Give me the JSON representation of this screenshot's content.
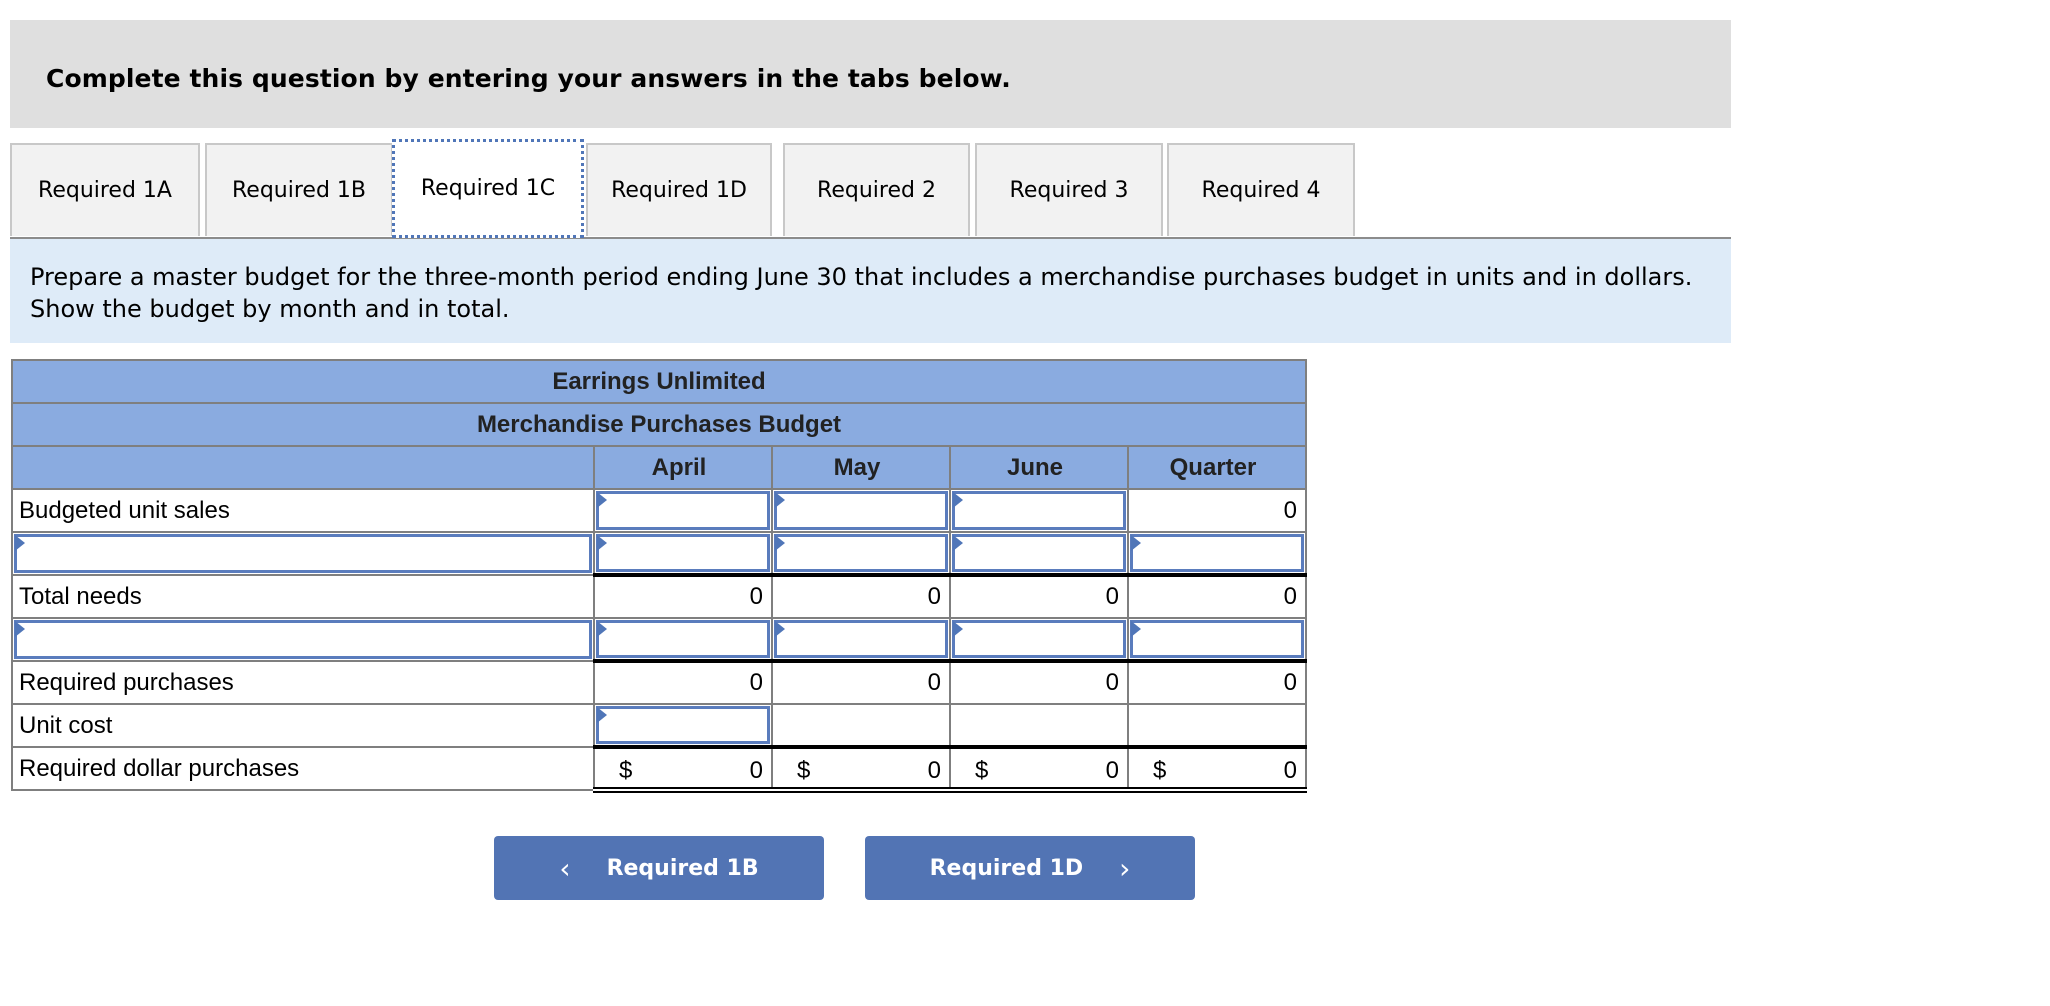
{
  "instruction": "Complete this question by entering your answers in the tabs below.",
  "tabs": [
    {
      "label": "Required 1A",
      "active": false
    },
    {
      "label": "Required 1B",
      "active": false
    },
    {
      "label": "Required 1C",
      "active": true
    },
    {
      "label": "Required 1D",
      "active": false
    },
    {
      "label": "Required 2",
      "active": false
    },
    {
      "label": "Required 3",
      "active": false
    },
    {
      "label": "Required 4",
      "active": false
    }
  ],
  "description": "Prepare a master budget for the three-month period ending June 30 that includes a merchandise purchases budget in units and in dollars. Show the budget by month and in total.",
  "table": {
    "company": "Earrings Unlimited",
    "title": "Merchandise Purchases Budget",
    "columns": [
      "April",
      "May",
      "June",
      "Quarter"
    ],
    "rows": [
      {
        "label": "Budgeted unit sales",
        "label_input": false,
        "cells": [
          "",
          "",
          "",
          "0"
        ],
        "inputs": [
          true,
          true,
          true,
          false
        ]
      },
      {
        "label": "",
        "label_input": true,
        "cells": [
          "",
          "",
          "",
          ""
        ],
        "inputs": [
          true,
          true,
          true,
          true
        ]
      },
      {
        "label": "Total needs",
        "label_input": false,
        "cells": [
          "0",
          "0",
          "0",
          "0"
        ],
        "inputs": [
          false,
          false,
          false,
          false
        ]
      },
      {
        "label": "",
        "label_input": true,
        "cells": [
          "",
          "",
          "",
          ""
        ],
        "inputs": [
          true,
          true,
          true,
          true
        ]
      },
      {
        "label": "Required purchases",
        "label_input": false,
        "cells": [
          "0",
          "0",
          "0",
          "0"
        ],
        "inputs": [
          false,
          false,
          false,
          false
        ]
      },
      {
        "label": "Unit cost",
        "label_input": false,
        "cells": [
          "",
          "",
          "",
          ""
        ],
        "inputs": [
          true,
          false,
          false,
          false
        ]
      },
      {
        "label": "Required dollar purchases",
        "label_input": false,
        "currency": "$",
        "cells": [
          "0",
          "0",
          "0",
          "0"
        ],
        "inputs": [
          false,
          false,
          false,
          false
        ]
      }
    ]
  },
  "nav": {
    "prev_label": "Required 1B",
    "next_label": "Required 1D",
    "prev_icon": "chevron-left-icon",
    "next_icon": "chevron-right-icon"
  },
  "colors": {
    "header_blue": "#8aabe0",
    "button_blue": "#5274b4",
    "band_blue": "#deebf8",
    "instruction_gray": "#dfdfdf"
  }
}
